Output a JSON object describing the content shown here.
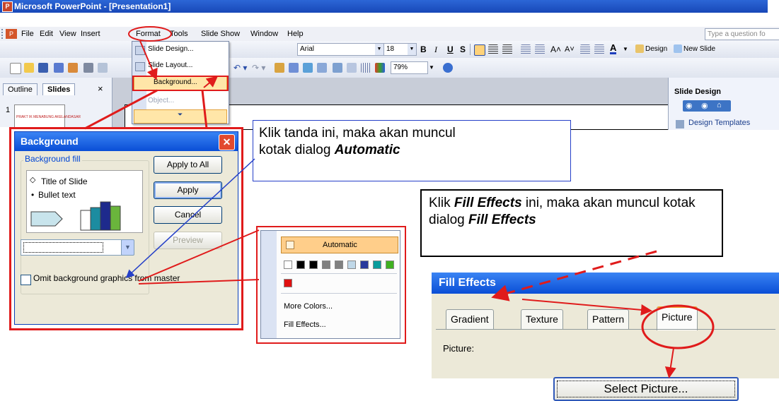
{
  "window": {
    "title": "Microsoft PowerPoint - [Presentation1]"
  },
  "menu": {
    "items": [
      "File",
      "Edit",
      "View",
      "Insert",
      "Format",
      "Tools",
      "Slide Show",
      "Window",
      "Help"
    ],
    "question_placeholder": "Type a question fo"
  },
  "toolbar": {
    "font": "Arial",
    "size": "18",
    "zoom": "79%",
    "design_label": "Design",
    "new_slide_label": "New Slide"
  },
  "format_menu": {
    "items": [
      "Slide Design...",
      "Slide Layout...",
      "Background...",
      "Object..."
    ]
  },
  "panes": {
    "outline_tab": "Outline",
    "slides_tab": "Slides",
    "close": "×",
    "slide_number": "1",
    "thumb_title": "PRAKT IK MENABUNG AKELANDASAR"
  },
  "design_pane": {
    "title": "Slide Design",
    "link": "Design Templates"
  },
  "background_dialog": {
    "title": "Background",
    "group_label": "Background fill",
    "preview_title": "Title of Slide",
    "preview_bullet": "Bullet text",
    "apply_all": "Apply to All",
    "apply": "Apply",
    "cancel": "Cancel",
    "preview": "Preview",
    "omit_label": "Omit background graphics from master",
    "close": "✕"
  },
  "color_popup": {
    "automatic": "Automatic",
    "swatches": [
      "#ffffff",
      "#000000",
      "#000000",
      "#808080",
      "#808080",
      "#c0d8e8",
      "#2a3a9c",
      "#0a9c9c",
      "#40b020"
    ],
    "custom_swatch": "#e01010",
    "more_colors": "More Colors...",
    "fill_effects": "Fill Effects..."
  },
  "callouts": {
    "c1_text_a": "Klik tanda ini, maka akan muncul",
    "c1_text_b": "kotak dialog ",
    "c1_text_bold": "Automatic",
    "c2_text_a": "Klik ",
    "c2_bold_a": "Fill Effects",
    "c2_text_b": " ini, maka akan muncul kotak dialog ",
    "c2_bold_b": "Fill Effects"
  },
  "fill_effects": {
    "title": "Fill Effects",
    "tabs": [
      "Gradient",
      "Texture",
      "Pattern",
      "Picture"
    ],
    "picture_label": "Picture:",
    "select_button": "Select Picture..."
  },
  "colors": {
    "annotation_red": "#e01b1b",
    "xp_blue": "#0a4ed6",
    "highlight": "#ffce8a"
  }
}
